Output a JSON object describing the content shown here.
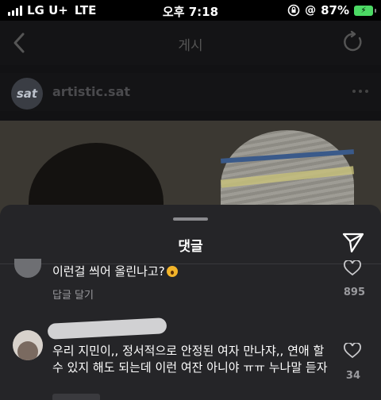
{
  "status_bar": {
    "carrier": "LG U+",
    "network": "LTE",
    "time": "오후 7:18",
    "battery": "87%"
  },
  "nav": {
    "title": "게시"
  },
  "post": {
    "username": "artistic.sat",
    "avatar_text": "sat"
  },
  "sheet": {
    "title": "댓글"
  },
  "comments": [
    {
      "text": "이런걸 씌어 올린나고?",
      "reply_label": "답글 달기",
      "likes": "895"
    },
    {
      "text": "우리 지민이,, 정서적으로 안정된 여자 만나쟈,, 연애 할 수 있지 해도 되는데 이런 여잔 아니야 ㅠㅠ 누나말 듣자",
      "likes": "34"
    }
  ],
  "colors": {
    "battery": "#4cd964",
    "sheet_bg": "#252528",
    "app_bg": "#0b0b0d"
  }
}
